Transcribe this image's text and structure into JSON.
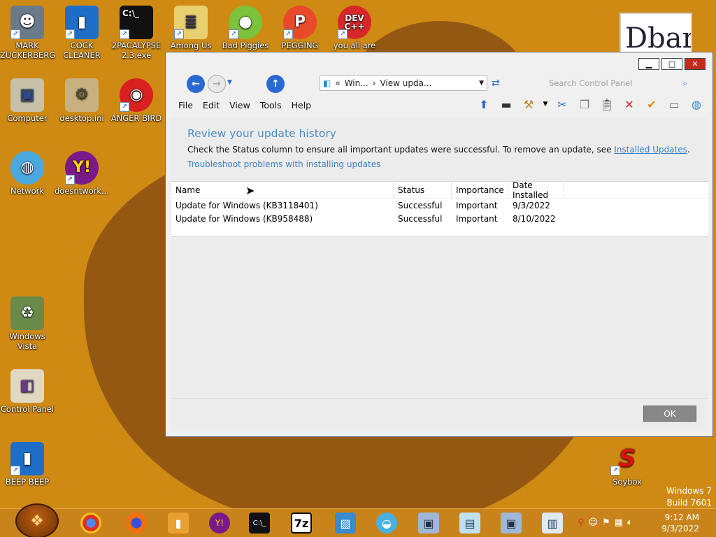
{
  "desktop": {
    "icons": [
      {
        "label": "MARK ZUCKERBERG",
        "icon": "person-icon"
      },
      {
        "label": "COCK CLEANER",
        "icon": "blue-book-icon"
      },
      {
        "label": "2PACALYPSE 2.3.exe",
        "icon": "console-icon"
      },
      {
        "label": "Among Us",
        "icon": "document-stack-icon"
      },
      {
        "label": "Bad Piggies",
        "icon": "pig-icon"
      },
      {
        "label": "PEGGING",
        "icon": "p-logo-icon"
      },
      {
        "label": "you all are",
        "icon": "dev-cpp-icon"
      },
      {
        "label": "Computer",
        "icon": "computer-icon"
      },
      {
        "label": "desktop.ini",
        "icon": "settings-file-icon"
      },
      {
        "label": "ANGER BIRD",
        "icon": "angry-bird-icon"
      },
      {
        "label": "Network",
        "icon": "network-globe-icon"
      },
      {
        "label": "doesntwork...",
        "icon": "yahoo-messenger-icon"
      },
      {
        "label": "Windows Vista",
        "icon": "recycle-bin-icon"
      },
      {
        "label": "Control Panel",
        "icon": "control-panel-icon"
      },
      {
        "label": "BEEP BEEP",
        "icon": "blue-book-icon"
      },
      {
        "label": "Soybox",
        "icon": "s-logo-icon"
      }
    ],
    "wallpaper_text": "Dbar",
    "watermark": {
      "line1": "Windows 7",
      "line2": "Build 7601"
    }
  },
  "window": {
    "address": {
      "part1": "Win...",
      "sep": "›",
      "part2": "View upda...",
      "chevrons": "«"
    },
    "search_placeholder": "Search Control Panel",
    "menu": [
      "File",
      "Edit",
      "View",
      "Tools",
      "Help"
    ],
    "heading": "Review your update history",
    "description": "Check the Status column to ensure all important updates were successful. To remove an update, see ",
    "description_link": "Installed Updates",
    "description_end": ".",
    "troubleshoot_link": "Troubleshoot problems with installing updates",
    "columns": [
      "Name",
      "Status",
      "Importance",
      "Date Installed"
    ],
    "rows": [
      {
        "name": "Update for Windows (KB3118401)",
        "status": "Successful",
        "importance": "Important",
        "date": "9/3/2022"
      },
      {
        "name": "Update for Windows (KB958488)",
        "status": "Successful",
        "importance": "Important",
        "date": "8/10/2022"
      }
    ],
    "ok_label": "OK"
  },
  "taskbar": {
    "clock_time": "9:12 AM",
    "clock_date": "9/3/2022",
    "apps": [
      "chrome-icon",
      "firefox-icon",
      "book-icon",
      "yahoo-messenger-icon",
      "console-icon",
      "7zip-icon",
      "photo-icon",
      "shell-icon",
      "network-icon",
      "notepad-icon",
      "computer-icon",
      "document-icon"
    ],
    "zip_label": "7z"
  }
}
